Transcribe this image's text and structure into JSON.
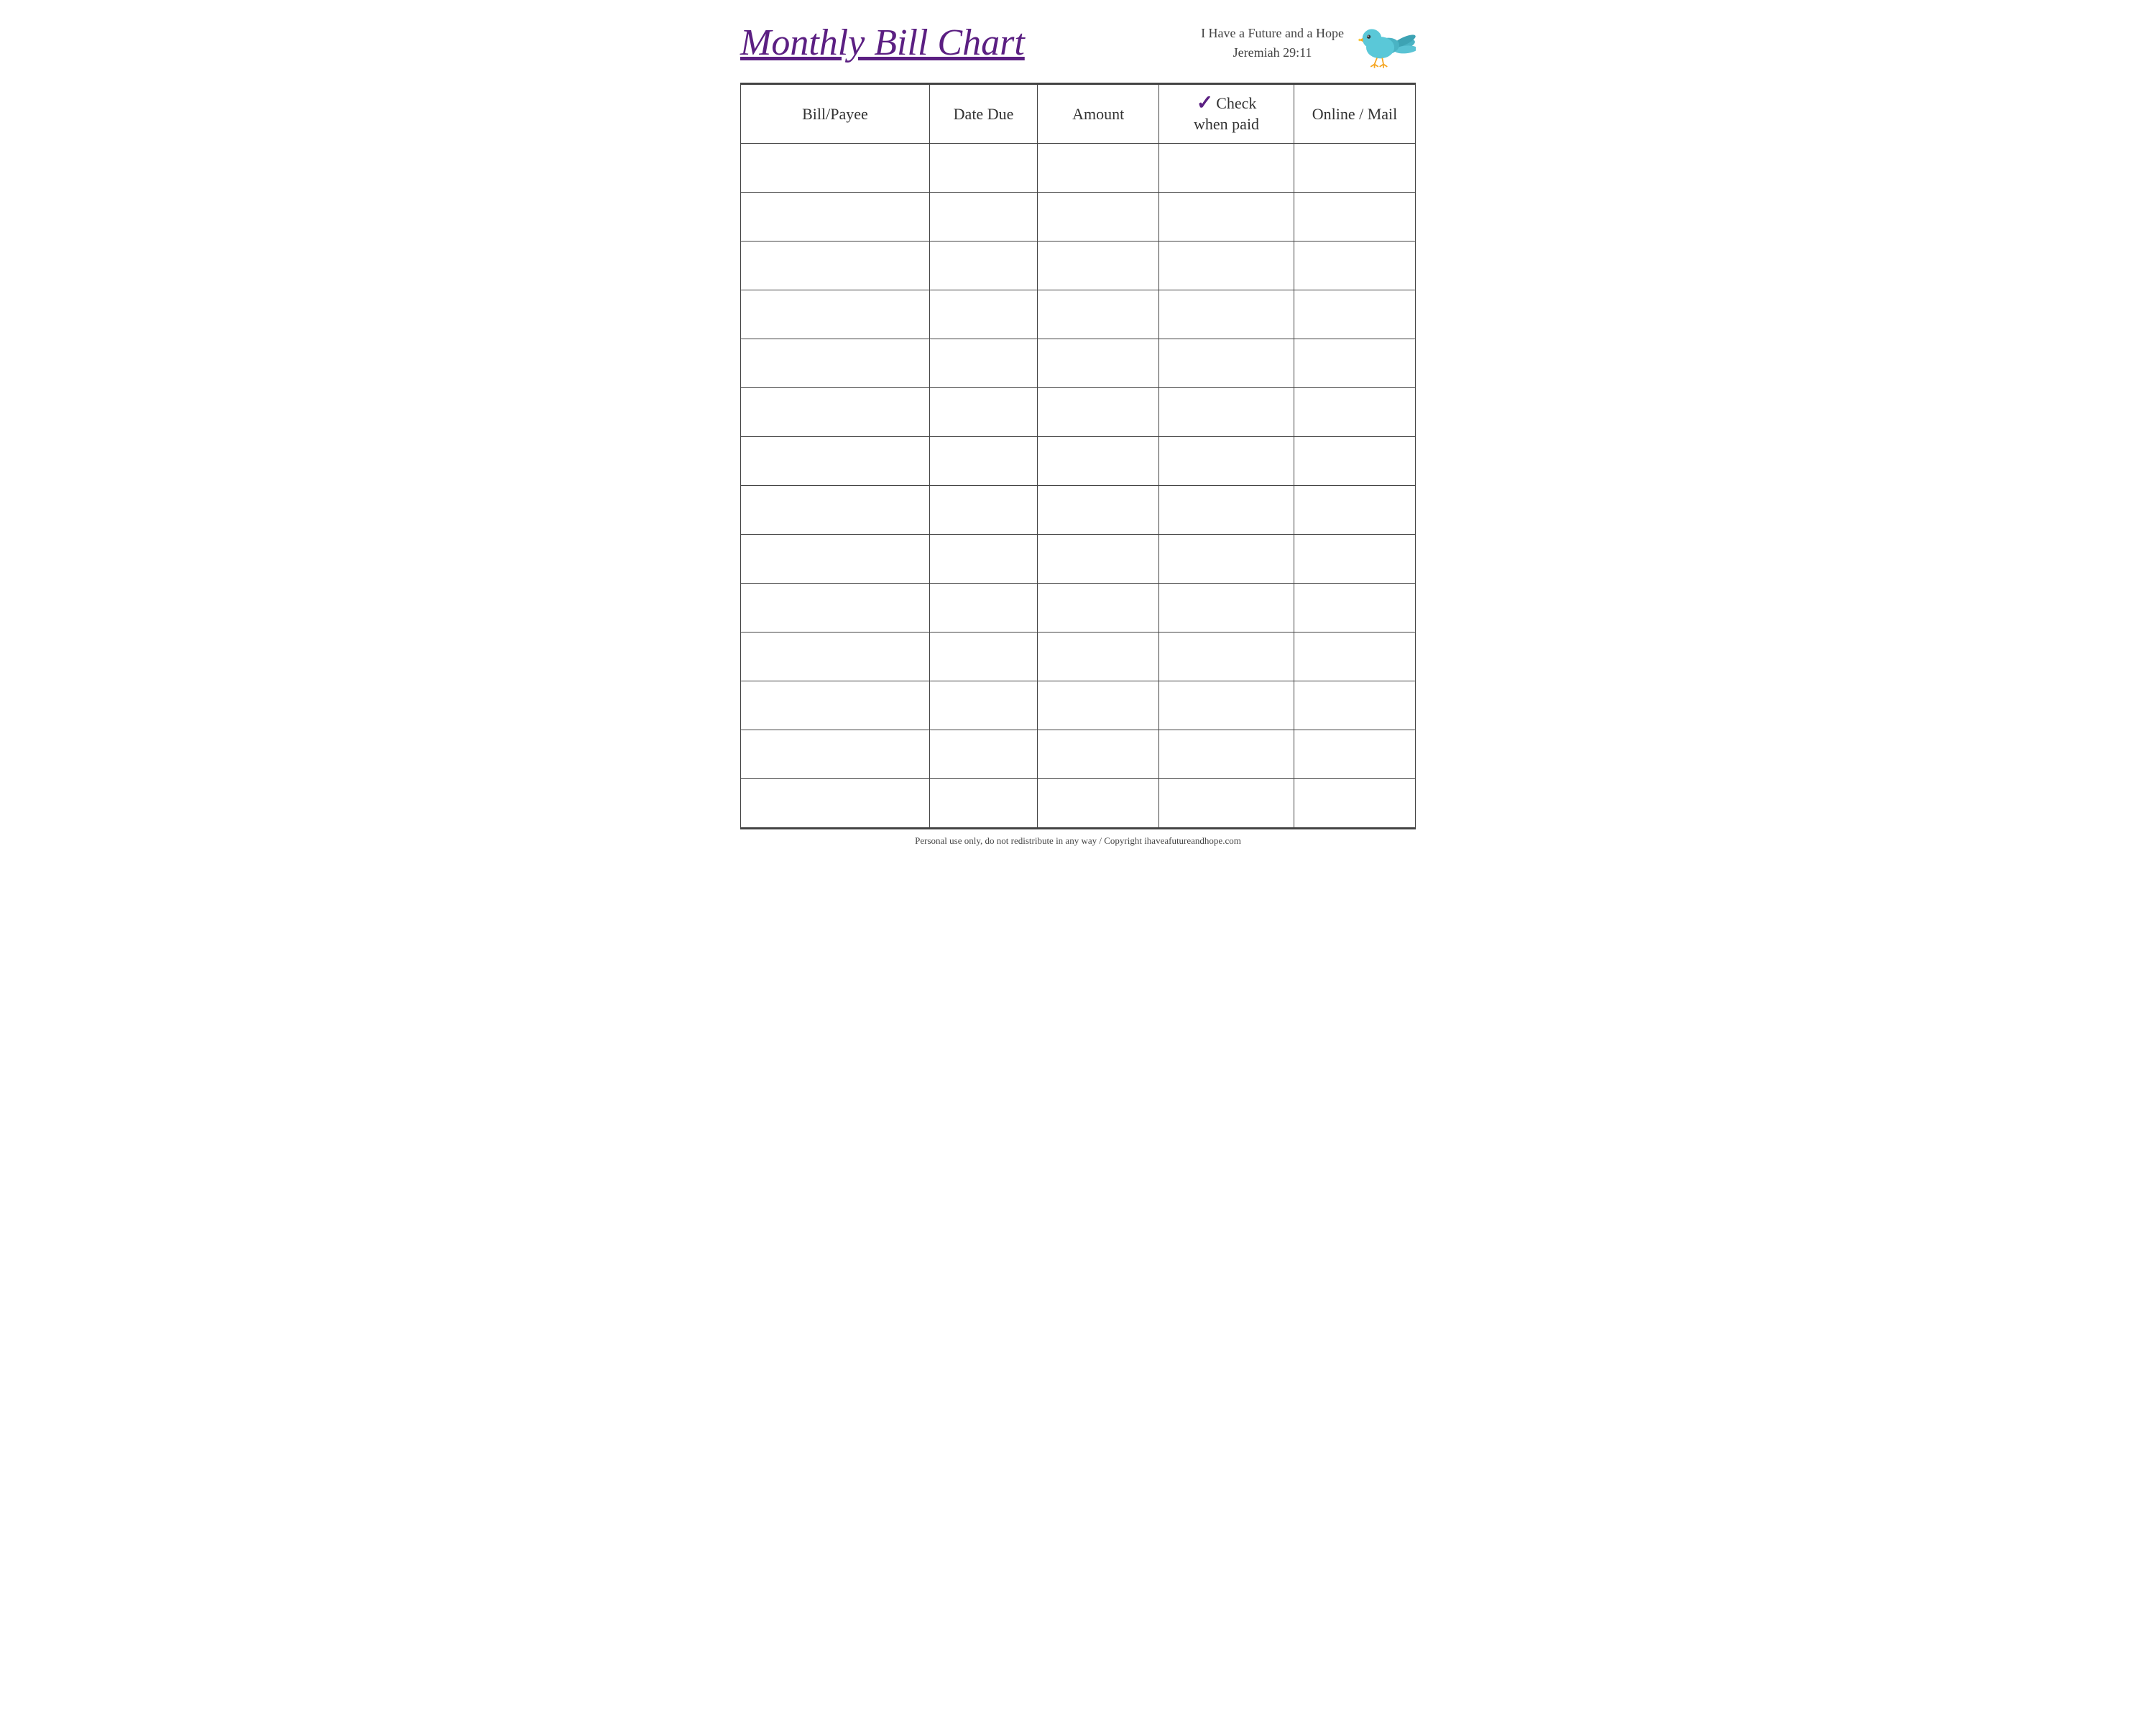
{
  "header": {
    "title": "Monthly Bill Chart",
    "tagline_line1": "I Have a Future and a Hope",
    "tagline_line2": "Jeremiah 29:11"
  },
  "table": {
    "columns": [
      {
        "id": "bill-payee",
        "label": "Bill/Payee"
      },
      {
        "id": "date-due",
        "label": "Date Due"
      },
      {
        "id": "amount",
        "label": "Amount"
      },
      {
        "id": "check-when-paid",
        "label_top": "Check",
        "label_bottom": "when paid",
        "has_checkmark": true
      },
      {
        "id": "online-mail",
        "label": "Online / Mail"
      }
    ],
    "row_count": 14
  },
  "footer": {
    "text": "Personal use only, do not redistribute in any way / Copyright ihaveafutureandhope.com"
  },
  "colors": {
    "title": "#5b1f82",
    "checkmark": "#5b1f82",
    "border": "#444444",
    "text": "#333333"
  }
}
